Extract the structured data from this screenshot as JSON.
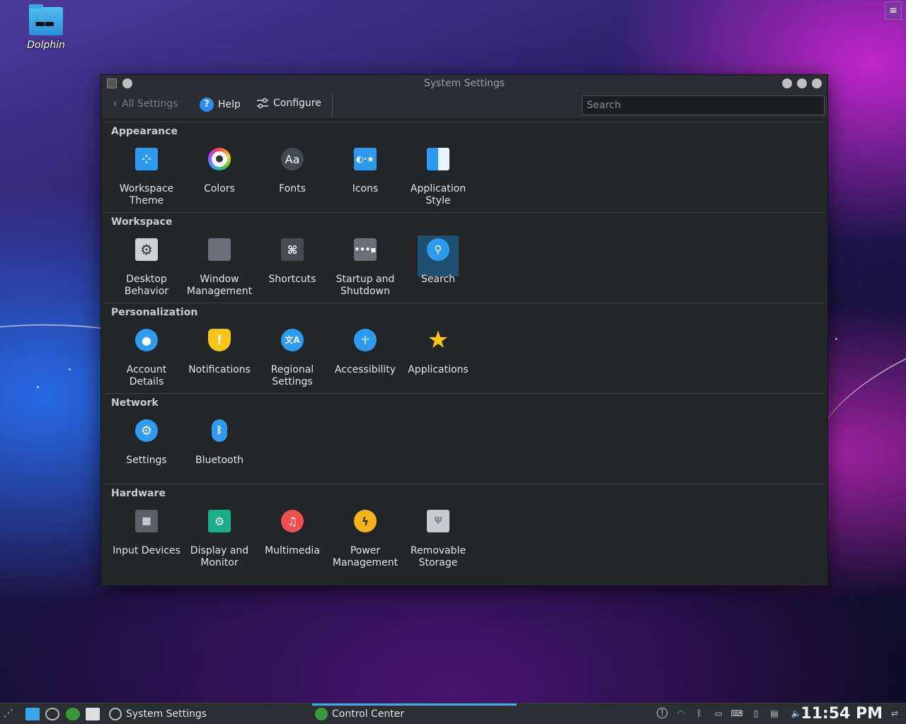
{
  "desktop": {
    "icon_label": "Dolphin",
    "menu_icon": "hamburger-icon"
  },
  "window": {
    "title": "System Settings",
    "toolbar": {
      "back_label": "All Settings",
      "help_label": "Help",
      "configure_label": "Configure",
      "search_placeholder": "Search"
    },
    "sections": [
      {
        "title": "Appearance",
        "items": [
          {
            "label": "Workspace Theme",
            "icon": "workspace-theme-icon",
            "color": "#2d9cf0"
          },
          {
            "label": "Colors",
            "icon": "colors-icon",
            "color": "#ffffff"
          },
          {
            "label": "Fonts",
            "icon": "fonts-icon",
            "color": "#3f4a55"
          },
          {
            "label": "Icons",
            "icon": "icons-icon",
            "color": "#2d9cf0"
          },
          {
            "label": "Application Style",
            "icon": "application-style-icon",
            "color": "#2d9cf0"
          }
        ]
      },
      {
        "title": "Workspace",
        "items": [
          {
            "label": "Desktop Behavior",
            "icon": "desktop-behavior-icon",
            "color": "#5a6068"
          },
          {
            "label": "Window Management",
            "icon": "window-management-icon",
            "color": "#6a7078"
          },
          {
            "label": "Shortcuts",
            "icon": "shortcuts-icon",
            "color": "#454b52"
          },
          {
            "label": "Startup and Shutdown",
            "icon": "startup-shutdown-icon",
            "color": "#6a7078"
          },
          {
            "label": "Search",
            "icon": "search-icon",
            "color": "#2d9cf0",
            "selected": true
          }
        ]
      },
      {
        "title": "Personalization",
        "items": [
          {
            "label": "Account Details",
            "icon": "account-details-icon",
            "color": "#2d9cf0"
          },
          {
            "label": "Notifications",
            "icon": "notifications-icon",
            "color": "#f5c518"
          },
          {
            "label": "Regional Settings",
            "icon": "regional-settings-icon",
            "color": "#2d9cf0"
          },
          {
            "label": "Accessibility",
            "icon": "accessibility-icon",
            "color": "#2d9cf0"
          },
          {
            "label": "Applications",
            "icon": "applications-icon",
            "color": "#f5c518"
          }
        ]
      },
      {
        "title": "Network",
        "items": [
          {
            "label": "Settings",
            "icon": "network-settings-icon",
            "color": "#2d9cf0"
          },
          {
            "label": "Bluetooth",
            "icon": "bluetooth-icon",
            "color": "#2d9cf0"
          }
        ]
      },
      {
        "title": "Hardware",
        "items": [
          {
            "label": "Input Devices",
            "icon": "input-devices-icon",
            "color": "#5a6068"
          },
          {
            "label": "Display and Monitor",
            "icon": "display-monitor-icon",
            "color": "#1aae8a"
          },
          {
            "label": "Multimedia",
            "icon": "multimedia-icon",
            "color": "#ef4f4f"
          },
          {
            "label": "Power Management",
            "icon": "power-management-icon",
            "color": "#f5b518"
          },
          {
            "label": "Removable Storage",
            "icon": "removable-storage-icon",
            "color": "#c8cbd0"
          }
        ]
      }
    ]
  },
  "taskbar": {
    "tasks": [
      {
        "label": "System Settings",
        "icon": "system-settings-icon"
      },
      {
        "label": "Control Center",
        "icon": "control-center-icon",
        "active": true
      }
    ],
    "clock": "11:54 PM"
  }
}
